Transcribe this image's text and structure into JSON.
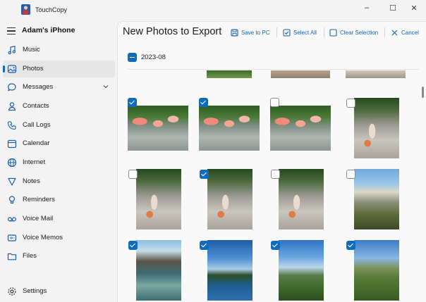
{
  "app": {
    "title": "TouchCopy"
  },
  "window_controls": {
    "minimize": "–",
    "maximize": "☐",
    "close": "✕"
  },
  "sidebar": {
    "device_name": "Adam's iPhone",
    "items": [
      {
        "label": "Music",
        "icon": "music-icon"
      },
      {
        "label": "Photos",
        "icon": "photos-icon",
        "active": true
      },
      {
        "label": "Messages",
        "icon": "messages-icon",
        "expandable": true
      },
      {
        "label": "Contacts",
        "icon": "contacts-icon"
      },
      {
        "label": "Call Logs",
        "icon": "phone-icon"
      },
      {
        "label": "Calendar",
        "icon": "calendar-icon"
      },
      {
        "label": "Internet",
        "icon": "globe-icon"
      },
      {
        "label": "Notes",
        "icon": "notes-icon"
      },
      {
        "label": "Reminders",
        "icon": "reminders-icon"
      },
      {
        "label": "Voice Mail",
        "icon": "voicemail-icon"
      },
      {
        "label": "Voice Memos",
        "icon": "voice-memos-icon"
      },
      {
        "label": "Files",
        "icon": "folder-icon"
      }
    ],
    "settings_label": "Settings"
  },
  "main": {
    "title": "New Photos to Export",
    "toolbar": {
      "save_label": "Save to PC",
      "select_all_label": "Select All",
      "clear_label": "Clear Selection",
      "cancel_label": "Cancel"
    },
    "group": {
      "label": "2023-08",
      "selected": true
    },
    "photos": [
      {
        "row": 1,
        "col": 1,
        "selected": true,
        "subject": "flamingos"
      },
      {
        "row": 1,
        "col": 2,
        "selected": true,
        "subject": "flamingos"
      },
      {
        "row": 1,
        "col": 3,
        "selected": false,
        "subject": "flamingos"
      },
      {
        "row": 1,
        "col": 4,
        "selected": false,
        "subject": "pond"
      },
      {
        "row": 2,
        "col": 1,
        "selected": false,
        "subject": "pond"
      },
      {
        "row": 2,
        "col": 2,
        "selected": true,
        "subject": "pond"
      },
      {
        "row": 2,
        "col": 3,
        "selected": false,
        "subject": "pond"
      },
      {
        "row": 2,
        "col": 4,
        "selected": false,
        "subject": "coast"
      },
      {
        "row": 3,
        "col": 1,
        "selected": true,
        "subject": "rock pools"
      },
      {
        "row": 3,
        "col": 2,
        "selected": true,
        "subject": "coast"
      },
      {
        "row": 3,
        "col": 3,
        "selected": true,
        "subject": "valley"
      },
      {
        "row": 3,
        "col": 4,
        "selected": true,
        "subject": "valley"
      }
    ]
  },
  "colors": {
    "accent": "#0f6cbd",
    "link": "#1a5fa8",
    "sidebar_bg": "#f3f3f3",
    "content_bg": "#f9f9f9"
  }
}
